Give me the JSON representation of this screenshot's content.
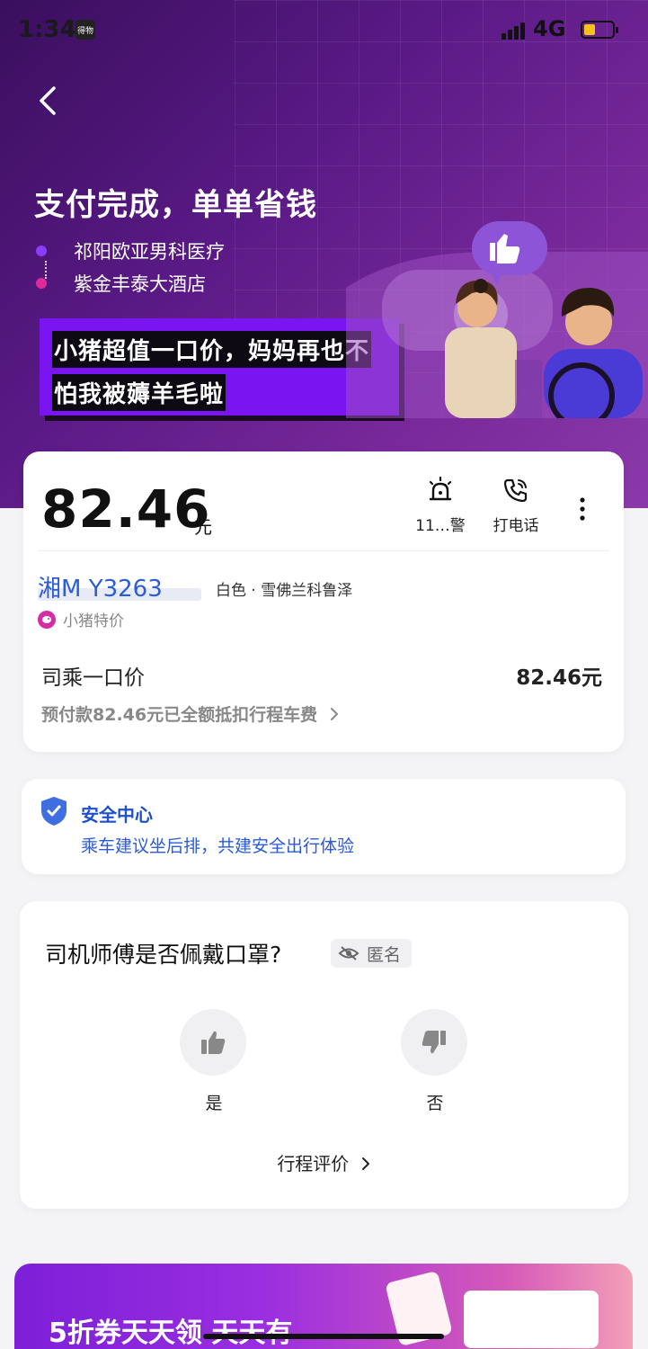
{
  "status_bar": {
    "time": "1:34",
    "badge": "得物",
    "network": "4G"
  },
  "hero": {
    "title": "支付完成，单单省钱",
    "route": {
      "origin": "祁阳欧亚男科医疗",
      "destination": "紫金丰泰大酒店"
    },
    "slogan_line1": "小猪超值一口价，妈妈再也不",
    "slogan_line2": "怕我被薅羊毛啦"
  },
  "trip_card": {
    "price": "82.46",
    "price_unit": "元",
    "actions": {
      "alarm_label": "11…警",
      "call_label": "打电话"
    },
    "plate": "湘M Y3263",
    "car_info": "白色 · 雪佛兰科鲁泽",
    "tag": "小猪特价",
    "fare_label": "司乘一口价",
    "fare_value": "82.46元",
    "fare_note": "预付款82.46元已全额抵扣行程车费"
  },
  "safety": {
    "title": "安全中心",
    "subtitle": "乘车建议坐后排，共建安全出行体验"
  },
  "survey": {
    "question": "司机师傅是否佩戴口罩?",
    "anonymous_label": "匿名",
    "yes_label": "是",
    "no_label": "否",
    "trip_eval_label": "行程评价"
  },
  "promo": {
    "text": "5折券天天领 天天有"
  },
  "colors": {
    "hero_purple": "#5a1a86",
    "slogan_purple": "#7a14f0",
    "plate_blue": "#2b5dd6",
    "safety_blue": "#1e4fd1",
    "tag_pink": "#d42ea6"
  },
  "icons": [
    "back-icon",
    "alarm-icon",
    "phone-icon",
    "more-icon",
    "shield-icon",
    "eye-off-icon",
    "thumbs-up-icon",
    "thumbs-down-icon",
    "chevron-right-icon"
  ]
}
